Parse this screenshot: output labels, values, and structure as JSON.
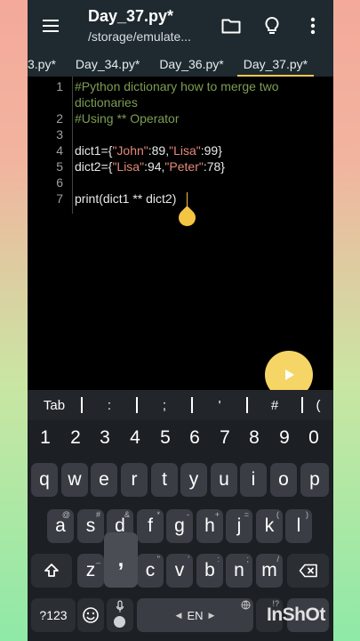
{
  "app": {
    "file_title": "Day_37.py*",
    "file_path": "/storage/emulate..."
  },
  "tabs": [
    {
      "label": "3.py*"
    },
    {
      "label": "Day_34.py*"
    },
    {
      "label": "Day_36.py*"
    },
    {
      "label": "Day_37.py*",
      "active": true
    }
  ],
  "editor": {
    "line_numbers": [
      "1",
      "2",
      "3",
      "4",
      "5",
      "6",
      "7"
    ],
    "lines": {
      "l1a": "#Python dictionary how to merge two",
      "l1b": "dictionaries",
      "l2": "#Using ** Operator",
      "l4_pre": "dict1={",
      "l4_s1": "\"John\"",
      "l4_mid": ":89,",
      "l4_s2": "\"Lisa\"",
      "l4_post": ":99}",
      "l5_pre": "dict2={",
      "l5_s1": "\"Lisa\"",
      "l5_mid": ":94,",
      "l5_s2": "\"Peter\"",
      "l5_post": ":78}",
      "l7": "print(dict1 ** dict2)"
    }
  },
  "symbols": [
    "Tab",
    ":",
    ";",
    "'",
    "#",
    "("
  ],
  "keyboard": {
    "numbers": [
      "1",
      "2",
      "3",
      "4",
      "5",
      "6",
      "7",
      "8",
      "9",
      "0"
    ],
    "row1": [
      "q",
      "w",
      "e",
      "r",
      "t",
      "y",
      "u",
      "i",
      "o",
      "p"
    ],
    "row2": [
      {
        "key": "a",
        "hint": "@"
      },
      {
        "key": "s",
        "hint": "#"
      },
      {
        "key": "d",
        "hint": "&"
      },
      {
        "key": "f",
        "hint": "*"
      },
      {
        "key": "g",
        "hint": "-"
      },
      {
        "key": "h",
        "hint": "+"
      },
      {
        "key": "j",
        "hint": "="
      },
      {
        "key": "k",
        "hint": "("
      },
      {
        "key": "l",
        "hint": ")"
      }
    ],
    "row3": [
      {
        "key": "z",
        "hint": "_"
      },
      {
        "key": "x",
        "hint": "$"
      },
      {
        "key": "c",
        "hint": "\""
      },
      {
        "key": "v",
        "hint": "'"
      },
      {
        "key": "b",
        "hint": ":"
      },
      {
        "key": "n",
        "hint": ";"
      },
      {
        "key": "m",
        "hint": "/"
      }
    ],
    "popup": ",",
    "mode_key": "?123",
    "space_label": "EN",
    "punct_hint": "!?",
    "period": "."
  },
  "watermark": "InShOt",
  "colors": {
    "appbar": "#1e2a30",
    "accent": "#f4c542",
    "comment": "#7d9d52",
    "string": "#e58a7a"
  }
}
